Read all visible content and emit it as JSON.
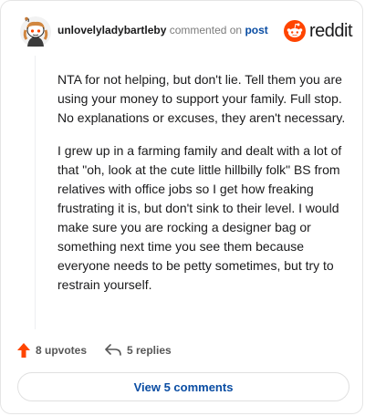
{
  "comment": {
    "username": "unlovelyladybartleby",
    "action": "commented on",
    "post_link": "post",
    "paragraphs": [
      "NTA for not helping, but don't lie. Tell them you are using your money to support your family. Full stop. No explanations or excuses, they aren't necessary.",
      "I grew up in a farming family and dealt with a lot of that \"oh, look at the cute little hillbilly folk\" BS from relatives with office jobs so I get how freaking frustrating it is, but don't sink to their level. I would make sure you are rocking a designer bag or something next time you see them because everyone needs to be petty sometimes, but try to restrain yourself."
    ]
  },
  "brand": {
    "name": "reddit",
    "color": "#ff4500"
  },
  "footer": {
    "upvotes_label": "8 upvotes",
    "replies_label": "5 replies"
  },
  "view_button": {
    "label": "View 5 comments"
  },
  "colors": {
    "link": "#0a4da3",
    "upvote": "#ff4500",
    "muted": "#7c7c7c"
  }
}
